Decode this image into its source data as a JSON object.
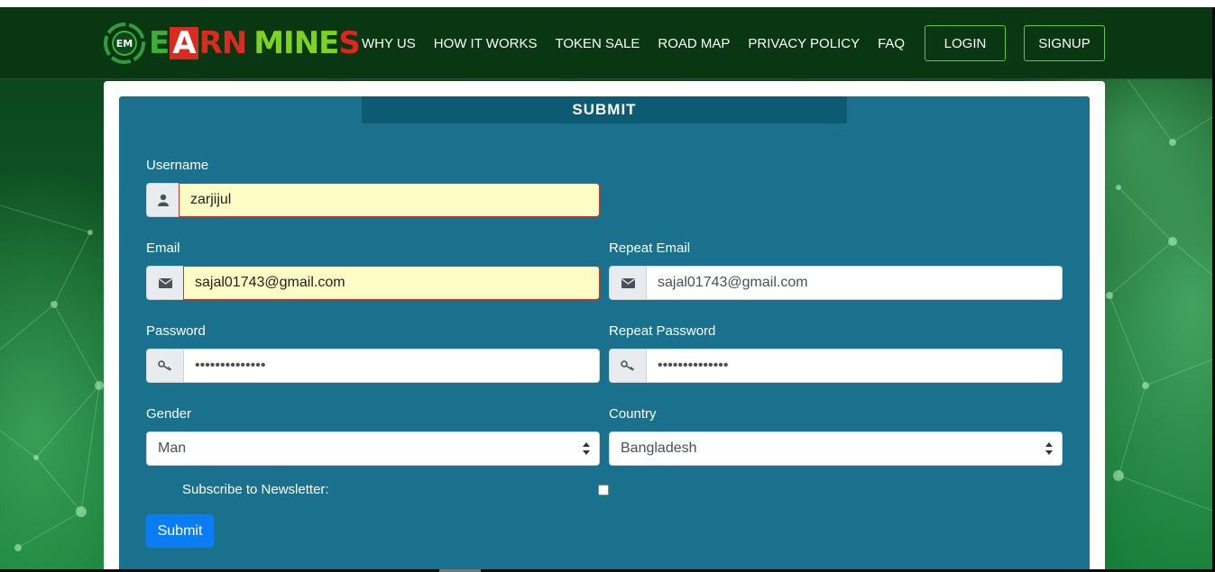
{
  "brand": {
    "mark_text": "EM",
    "name_part1_e": "E",
    "name_part1_a": "A",
    "name_part1_rn": "RN",
    "name_part2": "MINE",
    "name_part2_s": "S",
    "colors": {
      "green": "#3fae39",
      "red": "#d92b1e",
      "lime": "#7ed321"
    }
  },
  "nav": {
    "items": [
      {
        "label": "WHY US"
      },
      {
        "label": "HOW IT WORKS"
      },
      {
        "label": "TOKEN SALE"
      },
      {
        "label": "ROAD MAP"
      },
      {
        "label": "PRIVACY POLICY"
      },
      {
        "label": "FAQ"
      }
    ],
    "login": "LOGIN",
    "signup": "SIGNUP"
  },
  "form": {
    "title": "SUBMIT",
    "username": {
      "label": "Username",
      "value": "zarjijul",
      "icon": "user-icon"
    },
    "email": {
      "label": "Email",
      "value": "sajal01743@gmail.com",
      "icon": "envelope-icon"
    },
    "repeat_email": {
      "label": "Repeat Email",
      "value": "sajal01743@gmail.com",
      "icon": "envelope-icon"
    },
    "password": {
      "label": "Password",
      "value": "••••••••••••••",
      "icon": "key-icon"
    },
    "repeat_password": {
      "label": "Repeat Password",
      "value": "••••••••••••••",
      "icon": "key-icon"
    },
    "gender": {
      "label": "Gender",
      "selected": "Man"
    },
    "country": {
      "label": "Country",
      "selected": "Bangladesh"
    },
    "newsletter": {
      "label": "Subscribe to Newsletter:",
      "checked": false
    },
    "submit": "Submit"
  },
  "theme": {
    "panel": "#19718d",
    "panel_title": "#0d5a73",
    "header": "#083712",
    "button": "#0a7cf5"
  }
}
